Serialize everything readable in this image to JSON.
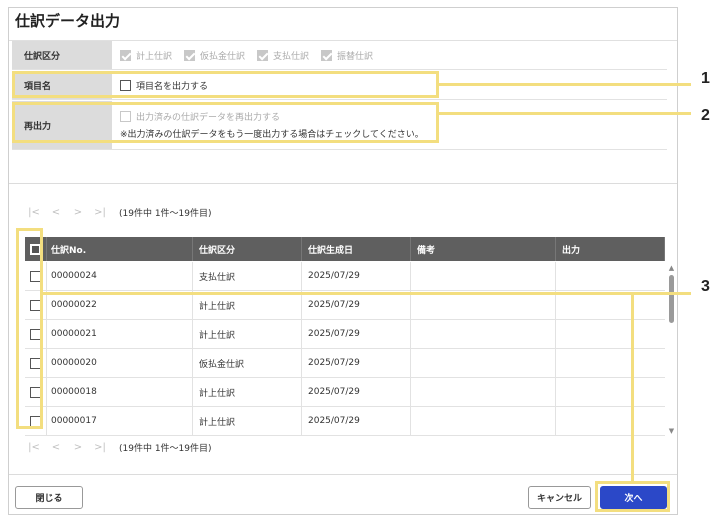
{
  "dialog": {
    "title": "仕訳データ出力"
  },
  "options": {
    "journal_type": {
      "label": "仕訳区分",
      "items": [
        "計上仕訳",
        "仮払金仕訳",
        "支払仕訳",
        "振替仕訳"
      ]
    },
    "item_name": {
      "label": "項目名",
      "checkbox_label": "項目名を出力する"
    },
    "reoutput": {
      "label": "再出力",
      "checkbox_label": "出力済みの仕訳データを再出力する",
      "note": "※出力済みの仕訳データをもう一度出力する場合はチェックしてください。"
    }
  },
  "pager": {
    "first": "|<",
    "prev": "<",
    "next": ">",
    "last": ">|",
    "count_text": "(19件中 1件～19件目)"
  },
  "table": {
    "headers": [
      "仕訳No.",
      "仕訳区分",
      "仕訳生成日",
      "備考",
      "出力"
    ],
    "rows": [
      {
        "no": "00000024",
        "kbn": "支払仕訳",
        "date": "2025/07/29",
        "biko": "",
        "out": ""
      },
      {
        "no": "00000022",
        "kbn": "計上仕訳",
        "date": "2025/07/29",
        "biko": "",
        "out": ""
      },
      {
        "no": "00000021",
        "kbn": "計上仕訳",
        "date": "2025/07/29",
        "biko": "",
        "out": ""
      },
      {
        "no": "00000020",
        "kbn": "仮払金仕訳",
        "date": "2025/07/29",
        "biko": "",
        "out": ""
      },
      {
        "no": "00000018",
        "kbn": "計上仕訳",
        "date": "2025/07/29",
        "biko": "",
        "out": ""
      },
      {
        "no": "00000017",
        "kbn": "計上仕訳",
        "date": "2025/07/29",
        "biko": "",
        "out": ""
      }
    ]
  },
  "buttons": {
    "close": "閉じる",
    "cancel": "キャンセル",
    "next": "次へ"
  },
  "callouts": [
    "1",
    "2",
    "3"
  ],
  "colors": {
    "highlight": "#f3de7f",
    "primary": "#2b48c8",
    "header_bg": "#5f5f5f",
    "label_bg": "#dcdcdc"
  },
  "icons": {
    "scroll_up": "triangle-up-icon",
    "scroll_down": "triangle-down-icon"
  }
}
